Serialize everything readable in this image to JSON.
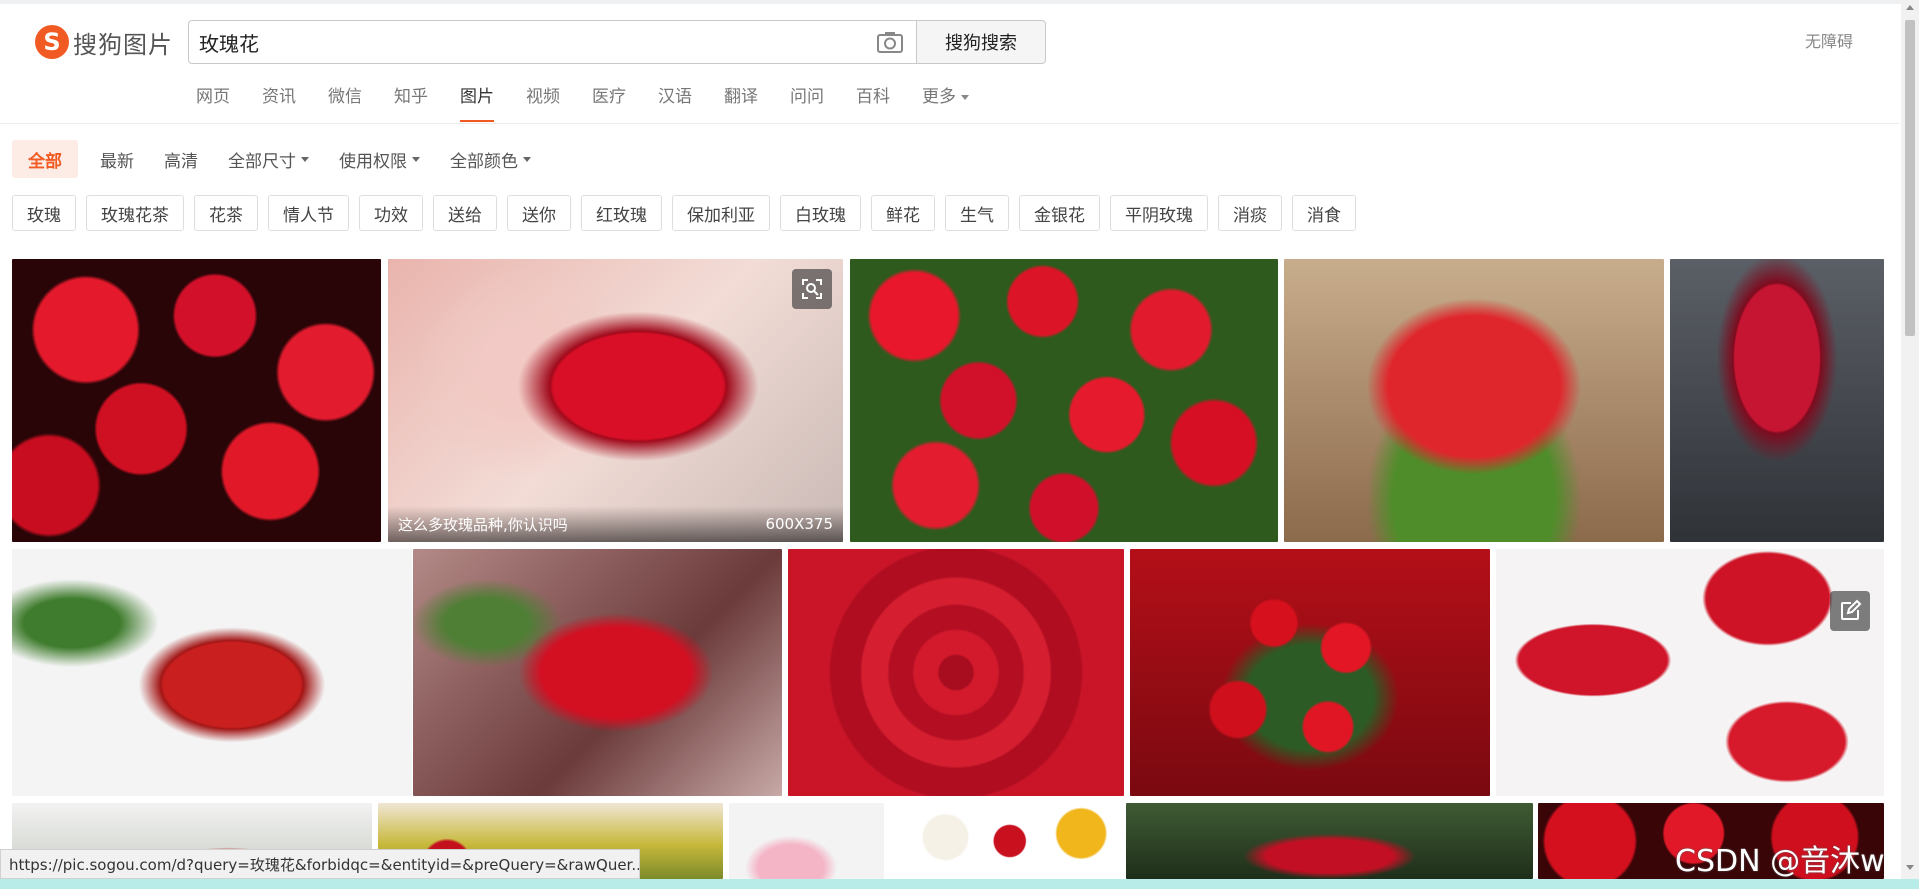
{
  "header": {
    "logo_text": "搜狗图片",
    "logo_mark": "S",
    "search_value": "玫瑰花",
    "search_button": "搜狗搜索",
    "accessibility": "无障碍"
  },
  "nav": {
    "items": [
      "网页",
      "资讯",
      "微信",
      "知乎",
      "图片",
      "视频",
      "医疗",
      "汉语",
      "翻译",
      "问问",
      "百科"
    ],
    "more": "更多",
    "active": "图片"
  },
  "filters": {
    "all": "全部",
    "latest": "最新",
    "hd": "高清",
    "size": "全部尺寸",
    "rights": "使用权限",
    "color": "全部颜色"
  },
  "tags": [
    "玫瑰",
    "玫瑰花茶",
    "花茶",
    "情人节",
    "功效",
    "送给",
    "送你",
    "红玫瑰",
    "保加利亚",
    "白玫瑰",
    "鲜花",
    "生气",
    "金银花",
    "平阴玫瑰",
    "消痰",
    "消食"
  ],
  "images": {
    "hover_caption": "这么多玫瑰品种,你认识吗",
    "hover_size": "600X375"
  },
  "status_bar": {
    "url": "https://pic.sogou.com/d?query=玫瑰花&forbidqc=&entityid=&preQuery=&rawQuer..."
  },
  "watermark": "CSDN @音沐w",
  "colors": {
    "accent": "#f15a22",
    "accent_bg": "#fdece6"
  },
  "icons": [
    "camera-icon",
    "image-search-icon",
    "edit-icon",
    "caret-down-icon"
  ]
}
